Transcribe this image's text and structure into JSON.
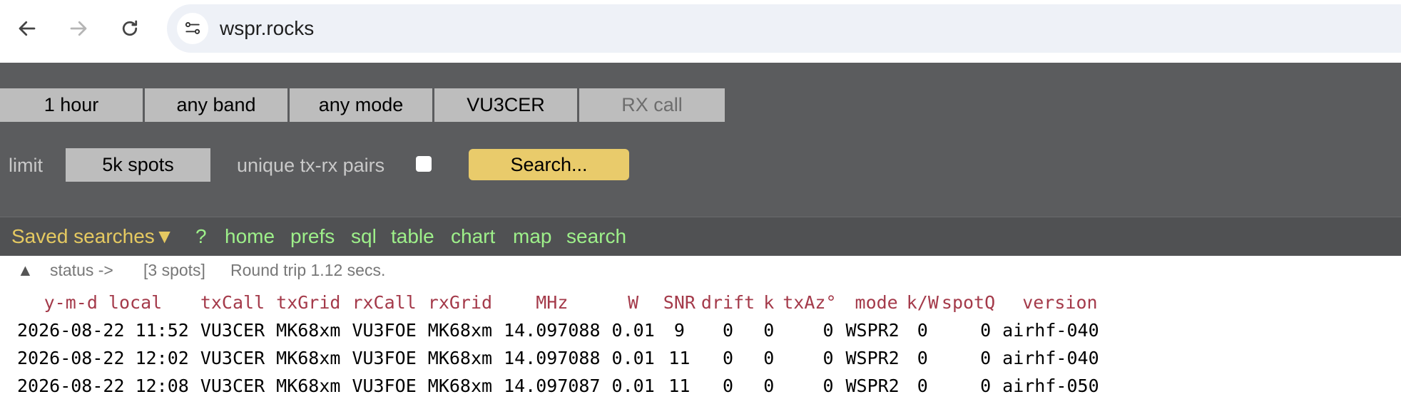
{
  "browser": {
    "url": "wspr.rocks",
    "icons": [
      "back-arrow-icon",
      "forward-arrow-icon",
      "reload-icon",
      "site-settings-icon"
    ]
  },
  "filters": {
    "time": "1 hour",
    "band": "any band",
    "mode": "any mode",
    "tx_call": "VU3CER",
    "rx_call_placeholder": "RX call",
    "limit_label": "limit",
    "limit_value": "5k spots",
    "unique_label": "unique tx-rx pairs",
    "unique_checked": false,
    "search_label": "Search..."
  },
  "nav": {
    "saved_searches": "Saved searches▼",
    "links": [
      "?",
      "home",
      "prefs",
      "sql",
      "table",
      "chart",
      "map",
      "search"
    ]
  },
  "status": {
    "toggle": "▲",
    "label": "status ->",
    "count": "[3 spots]",
    "round_trip": "Round trip 1.12 secs."
  },
  "table": {
    "headers": [
      "y-m-d local",
      "txCall",
      "txGrid",
      "rxCall",
      "rxGrid",
      "MHz",
      "W",
      "SNR",
      "drift",
      "k",
      "txAz°",
      "mode",
      "k/W",
      "spotQ",
      "version"
    ],
    "rows": [
      [
        "2026-08-22 11:52",
        "VU3CER",
        "MK68xm",
        "VU3FOE",
        "MK68xm",
        "14.097088",
        "0.01",
        "9",
        "0",
        "0",
        "0",
        "WSPR2",
        "0",
        "0",
        "airhf-040"
      ],
      [
        "2026-08-22 12:02",
        "VU3CER",
        "MK68xm",
        "VU3FOE",
        "MK68xm",
        "14.097088",
        "0.01",
        "11",
        "0",
        "0",
        "0",
        "WSPR2",
        "0",
        "0",
        "airhf-040"
      ],
      [
        "2026-08-22 12:08",
        "VU3CER",
        "MK68xm",
        "VU3FOE",
        "MK68xm",
        "14.097087",
        "0.01",
        "11",
        "0",
        "0",
        "0",
        "WSPR2",
        "0",
        "0",
        "airhf-050"
      ]
    ]
  },
  "colors": {
    "panel_bg": "#5b5c5e",
    "header_text": "#a43a4a",
    "link_green": "#9ef08a",
    "saved_yellow": "#e5c961",
    "search_button": "#e9cb6b"
  }
}
